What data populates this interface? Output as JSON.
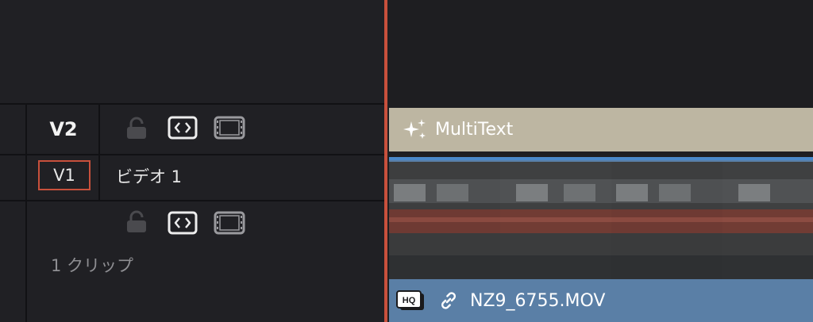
{
  "tracks": {
    "v2": {
      "label": "V2"
    },
    "v1": {
      "badge": "V1",
      "name": "ビデオ 1",
      "clip_count": "1 クリップ"
    }
  },
  "clips": {
    "multitext": {
      "label": "MultiText",
      "icon": "sparkle-icon"
    },
    "video": {
      "filename": "NZ9_6755.MOV",
      "badge": "HQ",
      "link_icon": "link-icon"
    }
  },
  "icons": {
    "lock": "lock-icon",
    "auto_select": "auto-select-icon",
    "film": "film-strip-icon"
  },
  "colors": {
    "playhead": "#c8503c",
    "multitext_clip": "#bdb6a2",
    "video_clip": "#5a7fa6",
    "v1_badge_border": "#c8503c"
  }
}
